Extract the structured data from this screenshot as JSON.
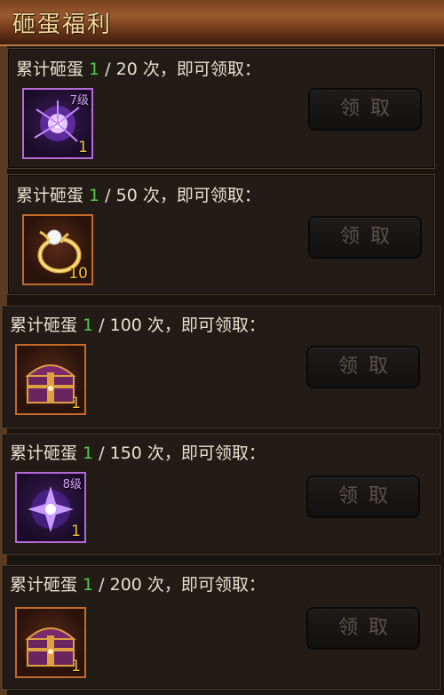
{
  "panel": {
    "title": "砸蛋福利"
  },
  "rows": [
    {
      "prefix": "累计砸蛋 ",
      "current": "1",
      "suffix": " / 20 次，即可领取：",
      "item_icon": "purple-orb-icon",
      "item_level": "7级",
      "item_qty": "1",
      "button_label": "领取"
    },
    {
      "prefix": "累计砸蛋 ",
      "current": "1",
      "suffix": " / 50 次，即可领取：",
      "item_icon": "gold-ring-icon",
      "item_level": "",
      "item_qty": "10",
      "button_label": "领取"
    },
    {
      "prefix": "累计砸蛋 ",
      "current": "1",
      "suffix": " / 100 次，即可领取：",
      "item_icon": "treasure-chest-icon",
      "item_level": "",
      "item_qty": "1",
      "button_label": "领取"
    },
    {
      "prefix": "累计砸蛋 ",
      "current": "1",
      "suffix": " / 150 次，即可领取：",
      "item_icon": "purple-star-orb-icon",
      "item_level": "8级",
      "item_qty": "1",
      "button_label": "领取"
    },
    {
      "prefix": "累计砸蛋 ",
      "current": "1",
      "suffix": " / 200 次，即可领取：",
      "item_icon": "treasure-chest-icon",
      "item_level": "",
      "item_qty": "1",
      "button_label": "领取"
    }
  ],
  "colors": {
    "progress_current": "#4ec94e",
    "quantity": "#f2c23a",
    "header_text": "#f4d89a"
  }
}
